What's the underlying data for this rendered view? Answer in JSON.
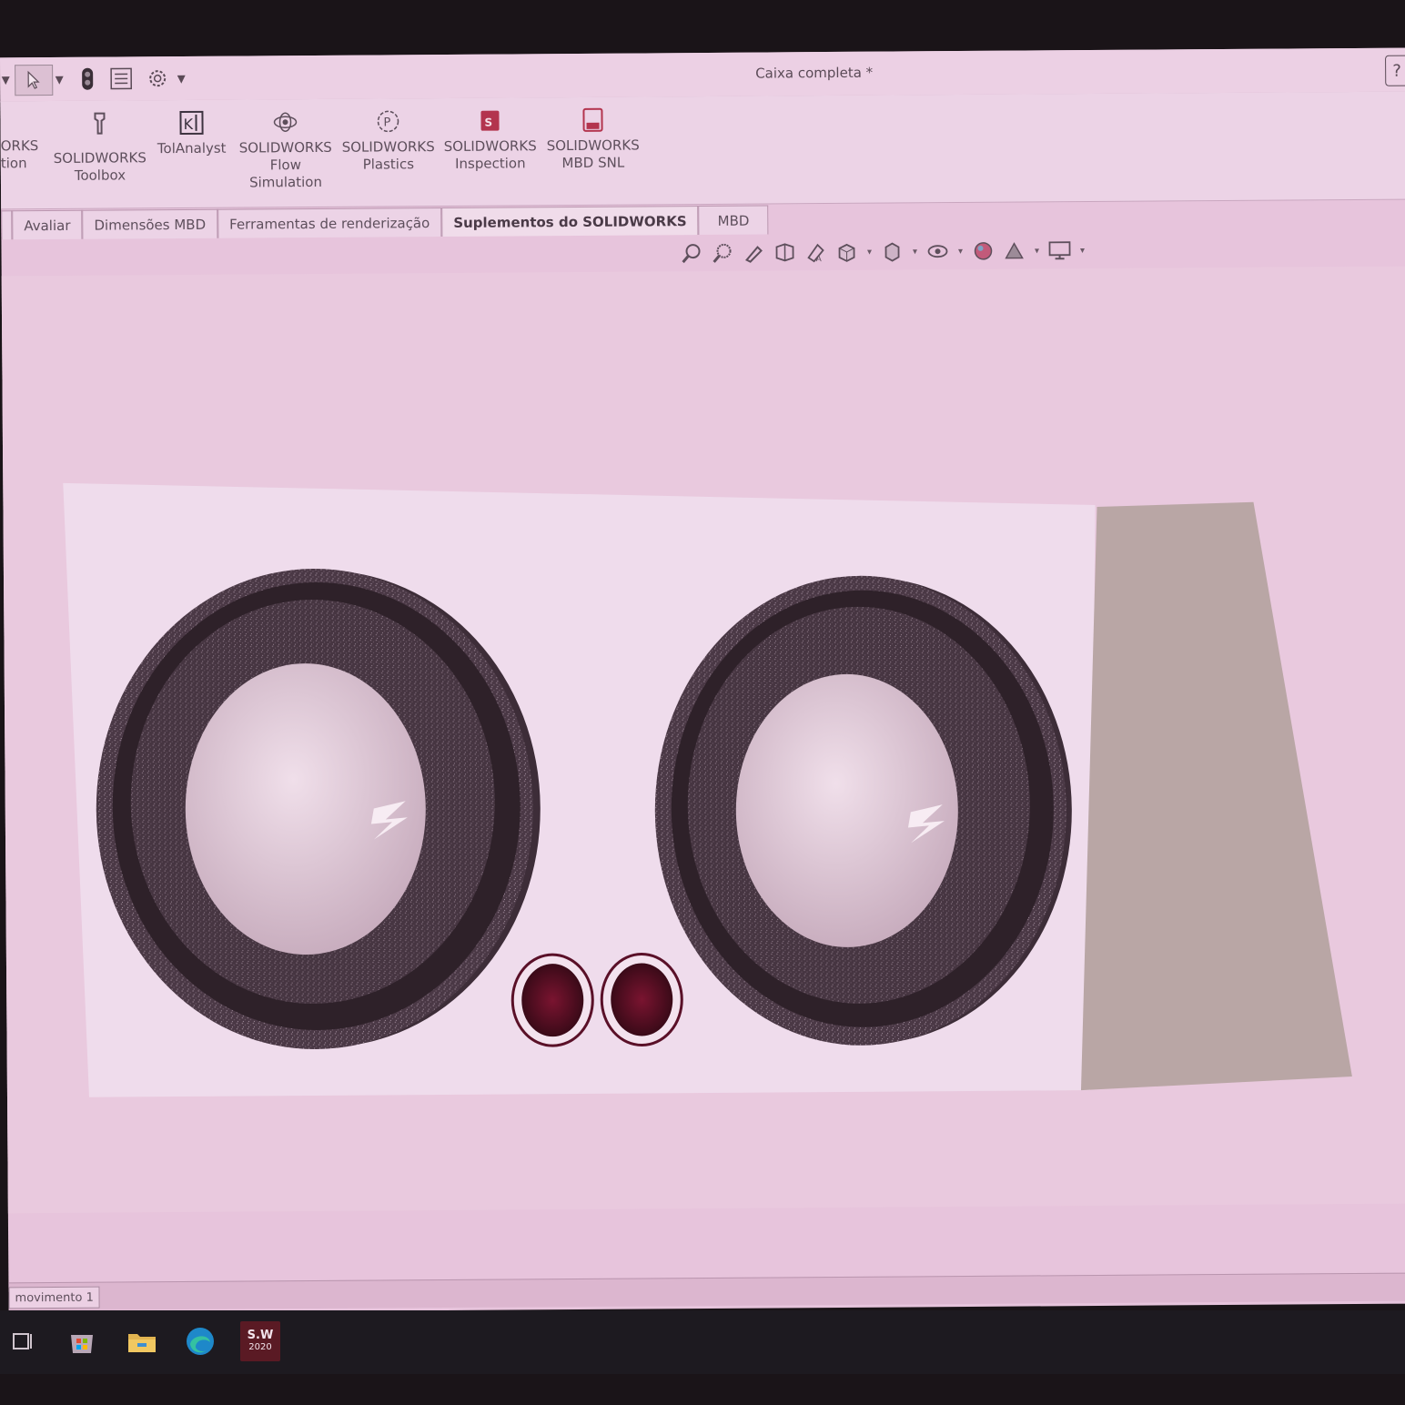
{
  "window": {
    "title": "Caixa completa *"
  },
  "ribbon": {
    "items": [
      {
        "label": "ORKS\ntion",
        "icon": "solidworks-addin-icon"
      },
      {
        "label": "SOLIDWORKS\nToolbox",
        "icon": "toolbox-icon"
      },
      {
        "label": "TolAnalyst",
        "icon": "tolanalyst-icon"
      },
      {
        "label": "SOLIDWORKS\nFlow\nSimulation",
        "icon": "flow-simulation-icon"
      },
      {
        "label": "SOLIDWORKS\nPlastics",
        "icon": "plastics-icon"
      },
      {
        "label": "SOLIDWORKS\nInspection",
        "icon": "inspection-icon"
      },
      {
        "label": "SOLIDWORKS\nMBD SNL",
        "icon": "mbd-snl-icon"
      }
    ]
  },
  "tabs": [
    {
      "label": "Avaliar",
      "active": false
    },
    {
      "label": "Dimensões MBD",
      "active": false
    },
    {
      "label": "Ferramentas de renderização",
      "active": false
    },
    {
      "label": "Suplementos do SOLIDWORKS",
      "active": true
    },
    {
      "label": "MBD",
      "active": false
    }
  ],
  "status": {
    "tab_label": "movimento 1"
  },
  "taskbar": {
    "solidworks_badge_top": "S.W",
    "solidworks_badge_year": "2020"
  },
  "colors": {
    "screen_bg": "#e7c4dc",
    "model_panel": "#eed9ea",
    "speaker_dark": "#3d2d38",
    "speaker_cone": "#d7bfd1",
    "side_panel": "#b9a6a5"
  }
}
